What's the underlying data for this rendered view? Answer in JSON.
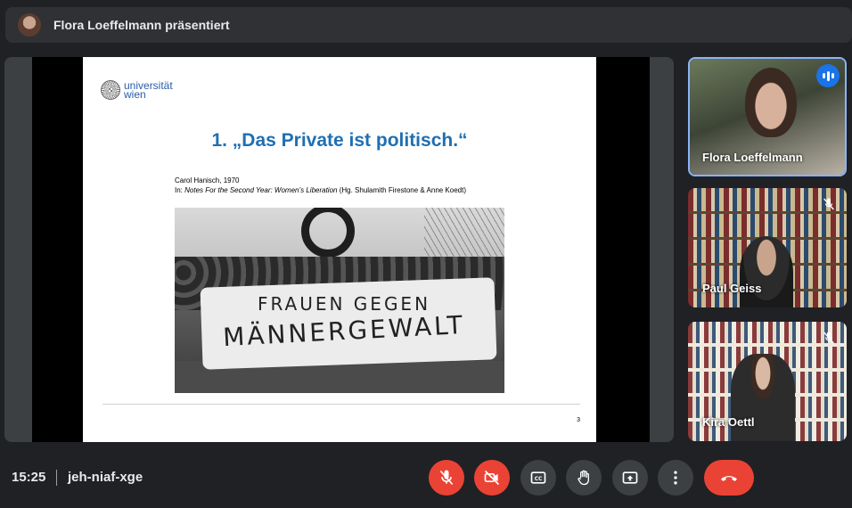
{
  "header": {
    "title": "Flora Loeffelmann präsentiert"
  },
  "slide": {
    "logo_text_line1": "universität",
    "logo_text_line2": "wien",
    "title": "1. „Das Private ist politisch.“",
    "citation_line1": "Carol Hanisch, 1970",
    "citation_prefix": "In: ",
    "citation_title": "Notes For the Second Year: Women’s Liberation",
    "citation_suffix": " (Hg. Shulamith Firestone & Anne Koedt)",
    "banner_line1": "FRAUEN GEGEN",
    "banner_line2": "MÄNNERGEWALT",
    "page_number": "3"
  },
  "participants": [
    {
      "name": "Flora Loeffelmann",
      "speaking": true
    },
    {
      "name": "Paul Geiss",
      "muted": true
    },
    {
      "name": "Kira Oettl",
      "muted": true
    }
  ],
  "footer": {
    "time": "15:25",
    "meeting_code": "jeh-niaf-xge"
  },
  "controls": {
    "icons": [
      "mic-off-icon",
      "camera-off-icon",
      "captions-icon",
      "raise-hand-icon",
      "present-icon",
      "more-options-icon",
      "end-call-icon"
    ]
  },
  "colors": {
    "background": "#202124",
    "panel": "#303134",
    "danger": "#ea4335",
    "accent": "#1a73e8",
    "slide_title": "#1f6fb2"
  }
}
